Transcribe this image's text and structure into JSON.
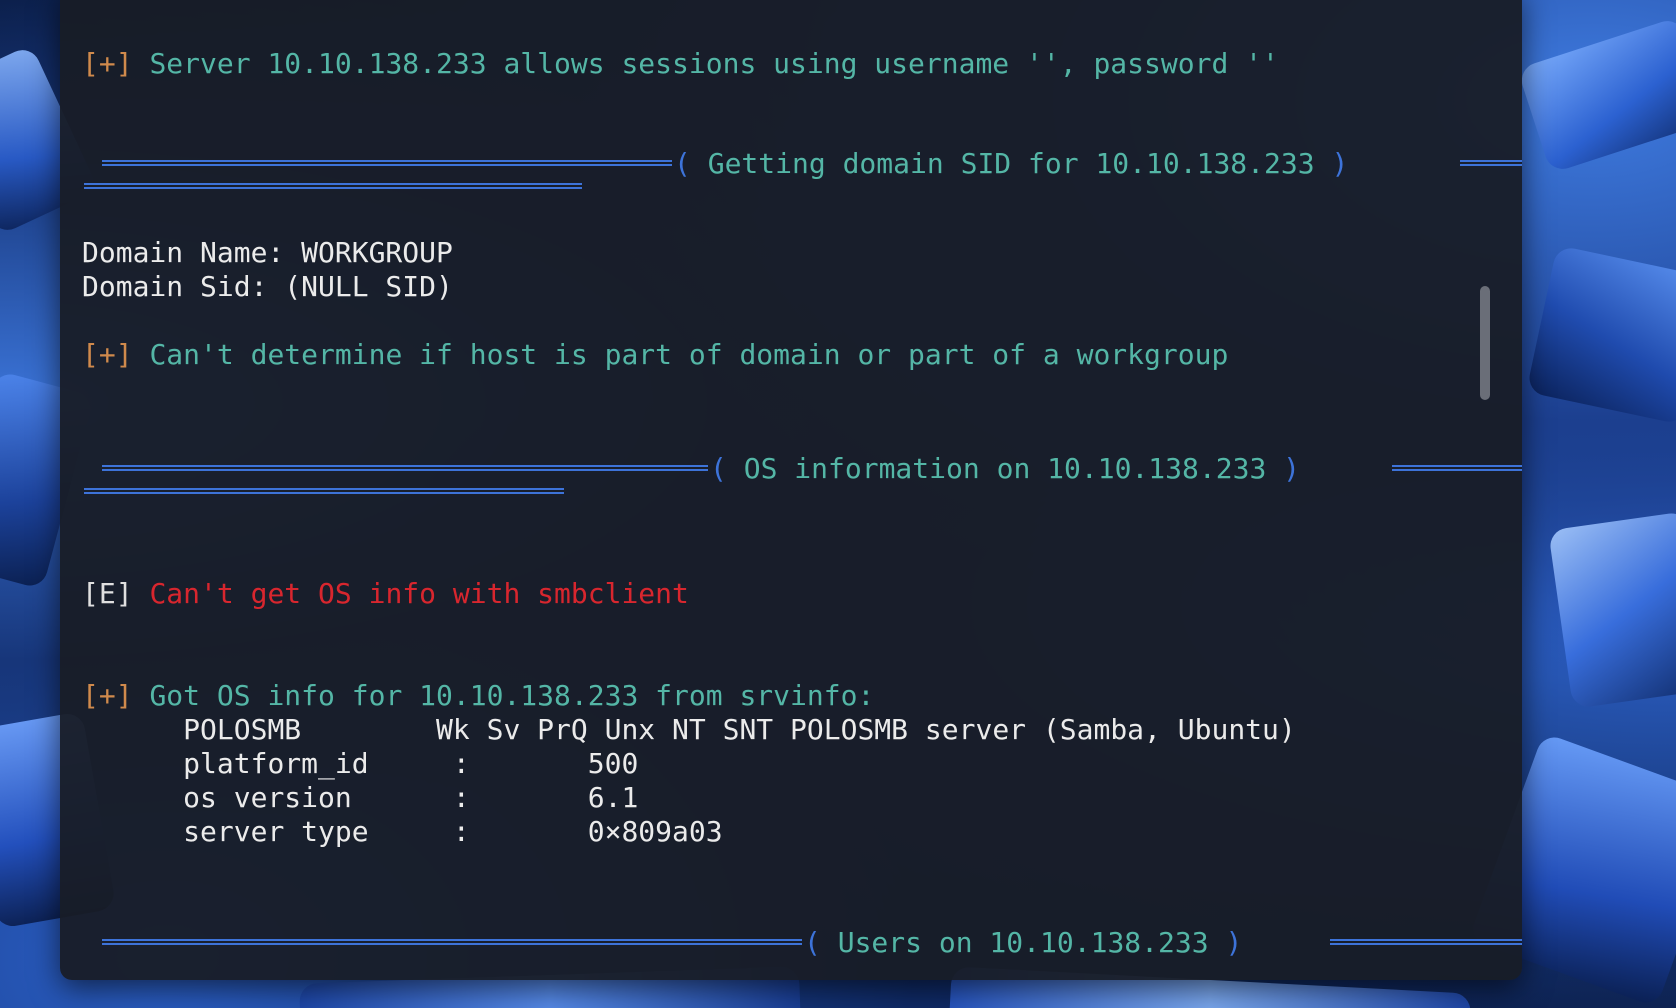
{
  "terminal": {
    "tag_plus": "[+]",
    "tag_err": "[E]",
    "line_server": "Server 10.10.138.233 allows sessions using username '', password ''",
    "section1": "Getting domain SID for 10.10.138.233",
    "domain_name": "Domain Name: WORKGROUP",
    "domain_sid": "Domain Sid: (NULL SID)",
    "line_cant_determine": "Can't determine if host is part of domain or part of a workgroup",
    "section2": "OS information on 10.10.138.233",
    "line_err": "Can't get OS info with smbclient",
    "line_got_os": "Got OS info for 10.10.138.233 from srvinfo:",
    "srvinfo": [
      "\tPOLOSMB        Wk Sv PrQ Unx NT SNT POLOSMB server (Samba, Ubuntu)",
      "\tplatform_id     :       500",
      "\tos version      :       6.1",
      "\tserver type     :       0×809a03"
    ],
    "section3": "Users on 10.10.138.233",
    "paren_open": "(",
    "paren_close": ")"
  },
  "colors": {
    "tag": "#d08a4c",
    "teal": "#54b6a6",
    "error": "#d8262e",
    "divider": "#3d73d9",
    "background": "#181c26"
  }
}
